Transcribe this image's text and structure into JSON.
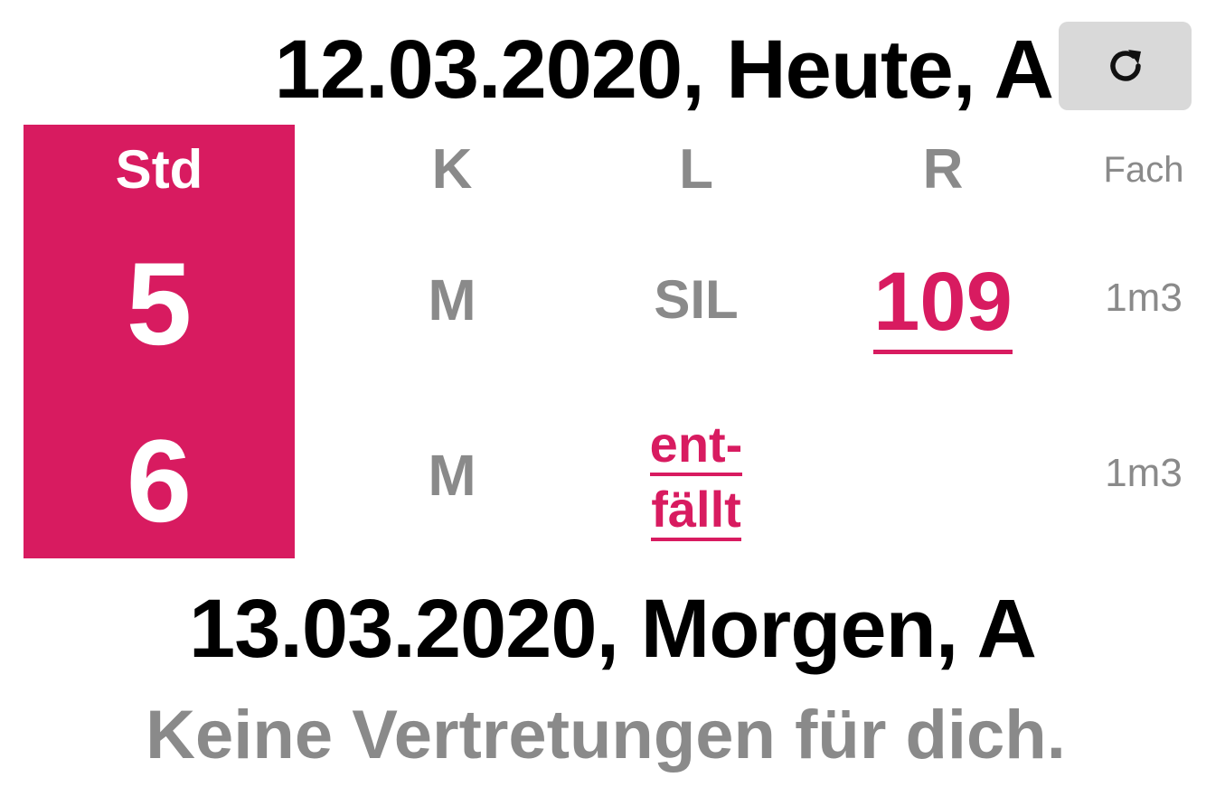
{
  "today": {
    "title": "12.03.2020, Heute, A",
    "refresh_icon": "refresh-icon",
    "columns": {
      "std": "Std",
      "k": "K",
      "l": "L",
      "r": "R",
      "fach": "Fach"
    },
    "rows": [
      {
        "std": "5",
        "k": "M",
        "l": "SIL",
        "r": "109",
        "fach": "1m3"
      },
      {
        "std": "6",
        "k": "M",
        "l_cancel_line1": "ent-",
        "l_cancel_line2": "fällt",
        "r": "",
        "fach": "1m3"
      }
    ]
  },
  "tomorrow": {
    "title": "13.03.2020, Morgen, A",
    "message": "Keine Vertretungen für dich."
  },
  "colors": {
    "accent": "#d81b60",
    "muted": "#8a8a8a",
    "button_bg": "#d9d9d9"
  }
}
